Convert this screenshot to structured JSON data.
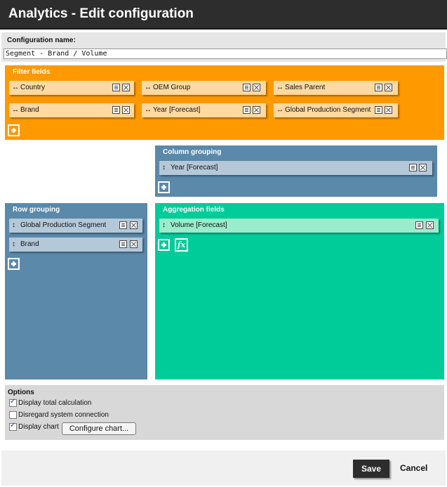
{
  "window": {
    "title": "Analytics - Edit configuration"
  },
  "configuration": {
    "label": "Configuration name:",
    "value": "Segment - Brand / Volume"
  },
  "filter_fields": {
    "title": "Filter fields",
    "items": [
      {
        "label": "Country",
        "icon": "horizontal-arrow-icon"
      },
      {
        "label": "OEM Group",
        "icon": "horizontal-arrow-icon"
      },
      {
        "label": "Sales Parent",
        "icon": "horizontal-arrow-icon"
      },
      {
        "label": "Brand",
        "icon": "horizontal-arrow-icon"
      },
      {
        "label": "Year [Forecast]",
        "icon": "horizontal-arrow-icon"
      },
      {
        "label": "Global Production Segment",
        "icon": "horizontal-arrow-icon"
      }
    ]
  },
  "column_grouping": {
    "title": "Column grouping",
    "items": [
      {
        "label": "Year [Forecast]",
        "icon": "vertical-arrow-icon"
      }
    ]
  },
  "row_grouping": {
    "title": "Row grouping",
    "items": [
      {
        "label": "Global Production Segment",
        "icon": "vertical-arrow-icon"
      },
      {
        "label": "Brand",
        "icon": "vertical-arrow-icon"
      }
    ]
  },
  "aggregation_fields": {
    "title": "Aggregation fields",
    "items": [
      {
        "label": "Volume [Forecast]",
        "icon": "vertical-arrow-icon"
      }
    ],
    "fx_label": "fx"
  },
  "glyphs": {
    "h_arrow": "↔",
    "v_arrow": "↕"
  },
  "options": {
    "title": "Options",
    "items": [
      {
        "label": "Display total calculation",
        "checked": true
      },
      {
        "label": "Disregard system connection",
        "checked": false
      },
      {
        "label": "Display chart",
        "checked": true
      }
    ],
    "configure_chart_label": "Configure chart..."
  },
  "footer": {
    "save_label": "Save",
    "cancel_label": "Cancel"
  },
  "colors": {
    "filter": "#ff9900",
    "grouping": "#5a89aa",
    "aggregation": "#00cc99",
    "titlebar": "#2d2d2d"
  }
}
